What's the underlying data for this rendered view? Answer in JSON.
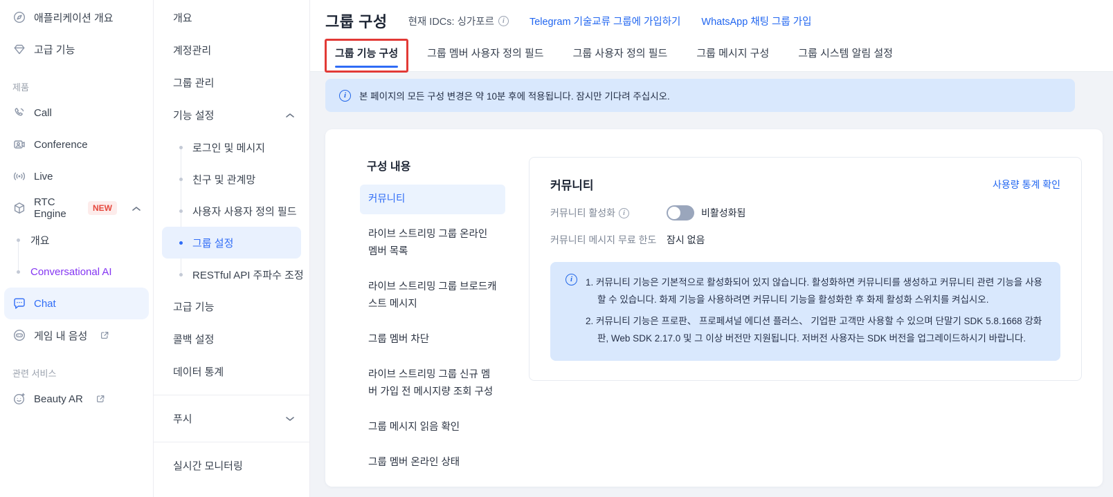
{
  "sidebar_primary": {
    "top_items": [
      {
        "label": "애플리케이션 개요"
      },
      {
        "label": "고급 기능"
      }
    ],
    "products_section_label": "제품",
    "items": {
      "call": "Call",
      "conference": "Conference",
      "live": "Live",
      "rtc_engine": "RTC Engine",
      "rtc_engine_badge": "NEW",
      "rtc_overview": "개요",
      "conversational_ai": "Conversational AI",
      "chat": "Chat",
      "in_game_voice": "게임 내 음성"
    },
    "related_section_label": "관련 서비스",
    "related_items": {
      "beauty_ar": "Beauty AR"
    }
  },
  "sidebar_secondary": {
    "overview": "개요",
    "account_mgmt": "계정관리",
    "group_mgmt": "그룹 관리",
    "feature_settings": "기능 설정",
    "children": [
      "로그인 및 메시지",
      "친구 및 관계망",
      "사용자 사용자 정의 필드",
      "그룹 설정",
      "RESTful API 주파수 조정"
    ],
    "advanced": "고급 기능",
    "callback": "콜백 설정",
    "data_stats": "데이터 통계",
    "push": "푸시",
    "realtime_monitoring": "실시간 모니터링"
  },
  "header": {
    "title": "그룹 구성",
    "idc": "현재 IDCs: 싱가포르",
    "telegram_link": "Telegram 기술교류 그룹에 가입하기",
    "whatsapp_link": "WhatsApp 채팅 그룹 가입"
  },
  "tabs": {
    "active_index": 0,
    "items": [
      "그룹 기능 구성",
      "그룹 멤버 사용자 정의 필드",
      "그룹 사용자 정의 필드",
      "그룹 메시지 구성",
      "그룹 시스템 알림 설정"
    ]
  },
  "banner": {
    "text": "본 페이지의 모든 구성 변경은 약 10분 후에 적용됩니다. 잠시만 기다려 주십시오."
  },
  "config_panel": {
    "heading": "구성 내용",
    "selected_index": 0,
    "items": [
      "커뮤니티",
      "라이브 스트리밍 그룹 온라인 멤버 목록",
      "라이브 스트리밍 그룹 브로드캐스트 메시지",
      "그룹 멤버 차단",
      "라이브 스트리밍 그룹 신규 멤버 가입 전 메시지량 조회 구성",
      "그룹 메시지 읽음 확인",
      "그룹 멤버 온라인 상태"
    ]
  },
  "community": {
    "title": "커뮤니티",
    "usage_link": "사용량 통계 확인",
    "enable_label": "커뮤니티 활성화",
    "toggle_state": "off",
    "enable_status": "비활성화됨",
    "quota_label": "커뮤니티 메시지 무료 한도",
    "quota_value": "잠시 없음",
    "notes": [
      "1. 커뮤니티 기능은 기본적으로 활성화되어 있지 않습니다. 활성화하면 커뮤니티를 생성하고 커뮤니티 관련 기능을 사용할 수 있습니다. 화제 기능을 사용하려면 커뮤니티 기능을 활성화한 후 화제 활성화 스위치를 켜십시오.",
      "2. 커뮤니티 기능은 프로판、 프로페셔널 에디션 플러스、 기업판 고객만 사용할 수 있으며 단말기 SDK 5.8.1668 강화판, Web SDK 2.17.0 및 그 이상 버전만 지원됩니다. 저버전 사용자는 SDK 버전을 업그레이드하시기 바랍니다."
    ]
  },
  "colors": {
    "accent_blue": "#2f6cf6",
    "link_blue": "#2166f0",
    "banner_bg": "#d9e8fd",
    "selected_pill_bg": "#ebf3fe",
    "badge_new_bg": "#fdeceb",
    "badge_new_text": "#e5483d",
    "conversational_ai_purple": "#8435f2",
    "annotation_red": "#e23a36",
    "page_bg": "#f1f3f7",
    "toggle_off_track": "#9aa6bc"
  }
}
